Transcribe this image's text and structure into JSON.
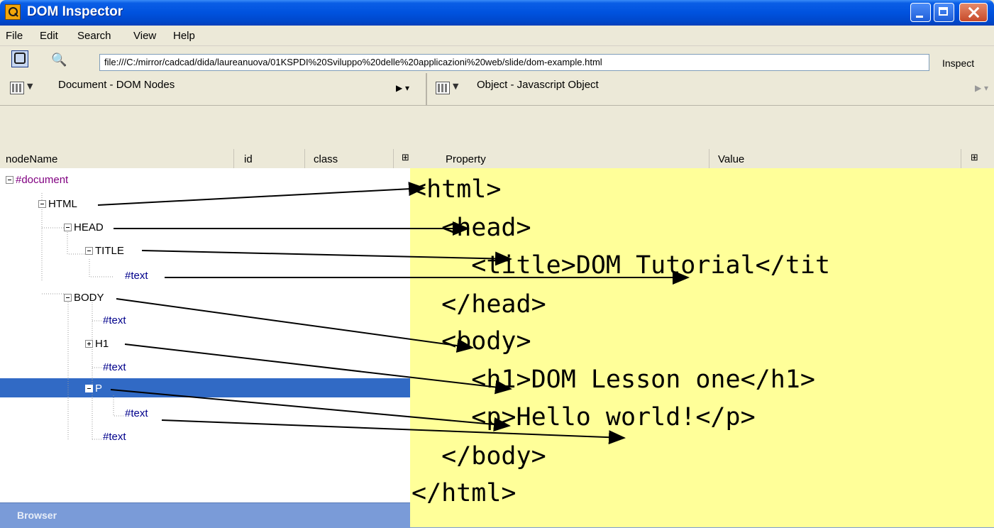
{
  "window": {
    "title": "DOM Inspector",
    "controls": [
      "minimize",
      "maximize",
      "close"
    ]
  },
  "menu": [
    "File",
    "Edit",
    "Search",
    "View",
    "Help"
  ],
  "toolbar": {
    "url": "file:///C:/mirror/cadcad/dida/laureanuova/01KSPDI%20Sviluppo%20delle%20applicazioni%20web/slide/dom-example.html",
    "inspect_label": "Inspect"
  },
  "left_pane": {
    "title": "Document - DOM Nodes",
    "columns": [
      "nodeName",
      "id",
      "class"
    ],
    "nodes": [
      "#document",
      "HTML",
      "HEAD",
      "TITLE",
      "#text",
      "BODY",
      "#text",
      "H1",
      "#text",
      "P",
      "#text",
      "#text"
    ]
  },
  "right_pane": {
    "title": "Object - Javascript Object",
    "columns": [
      "Property",
      "Value"
    ]
  },
  "status": "Browser",
  "code": [
    "<html>",
    "  <head>",
    "    <title>DOM Tutorial</tit",
    "  </head>",
    "  <body>",
    "    <h1>DOM Lesson one</h1>",
    "    <p>Hello world!</p>",
    "  </body>",
    "</html>"
  ]
}
